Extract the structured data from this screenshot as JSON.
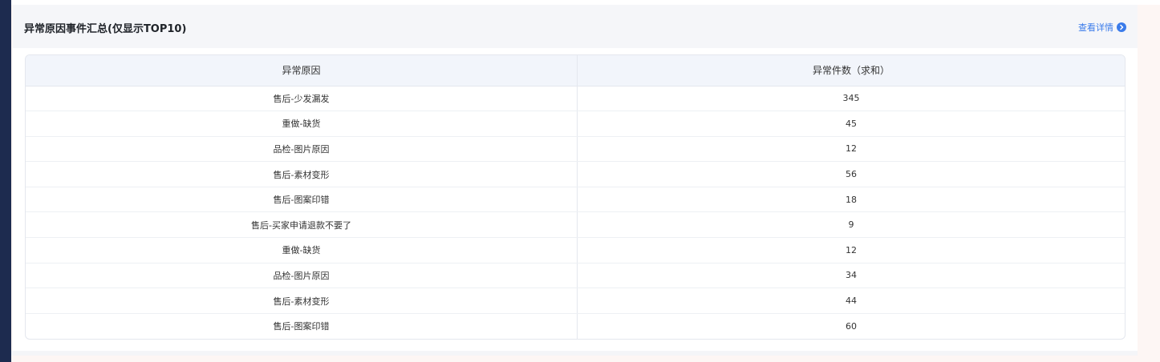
{
  "panel": {
    "title": "异常原因事件汇总(仅显示TOP10)",
    "detail_link": "查看详情",
    "detail_icon": "chevron-right-circle-icon",
    "accent_color": "#3a7bea"
  },
  "table": {
    "columns": [
      "异常原因",
      "异常件数（求和）"
    ],
    "rows": [
      {
        "reason": "售后-少发漏发",
        "count": "345"
      },
      {
        "reason": "重做-缺货",
        "count": "45"
      },
      {
        "reason": "品检-图片原因",
        "count": "12"
      },
      {
        "reason": "售后-素材变形",
        "count": "56"
      },
      {
        "reason": "售后-图案印错",
        "count": "18"
      },
      {
        "reason": "售后-买家申请退款不要了",
        "count": "9"
      },
      {
        "reason": "重做-缺货",
        "count": "12"
      },
      {
        "reason": "品检-图片原因",
        "count": "34"
      },
      {
        "reason": "售后-素材变形",
        "count": "44"
      },
      {
        "reason": "售后-图案印错",
        "count": "60"
      }
    ]
  }
}
